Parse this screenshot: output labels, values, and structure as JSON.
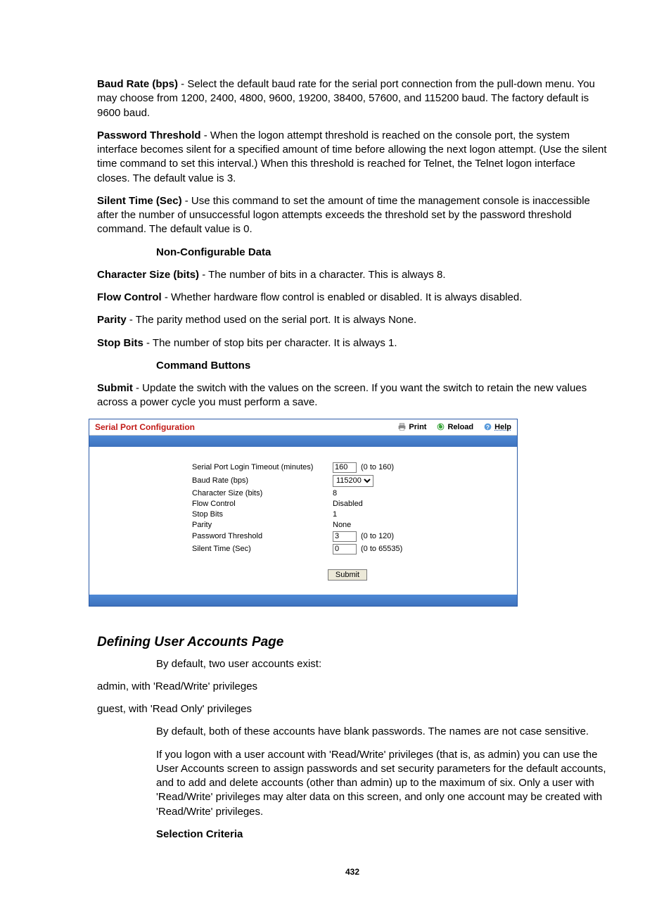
{
  "intro": [
    {
      "term": "Baud Rate (bps)",
      "text": " - Select the default baud rate for the serial port connection from the pull-down menu. You may choose from 1200, 2400, 4800, 9600, 19200, 38400, 57600, and 115200 baud. The factory default is 9600 baud."
    },
    {
      "term": "Password Threshold",
      "text": " - When the logon attempt threshold is reached on the console port, the system interface becomes silent for a specified amount of time before allowing the next logon attempt. (Use the silent time command to set this interval.) When this threshold is reached for Telnet, the Telnet logon interface closes. The default value is 3."
    },
    {
      "term": "Silent Time (Sec)",
      "text": " - Use this command to set the amount of time the management console is inaccessible after the number of unsuccessful logon attempts exceeds the threshold set by the password threshold command. The default value is 0."
    }
  ],
  "noncfg_heading": "Non-Configurable Data",
  "noncfg": [
    {
      "term": "Character Size (bits)",
      "text": " - The number of bits in a character. This is always 8."
    },
    {
      "term": "Flow Control",
      "text": " - Whether hardware flow control is enabled or disabled. It is always disabled."
    },
    {
      "term": "Parity",
      "text": " - The parity method used on the serial port. It is always None."
    },
    {
      "term": "Stop Bits",
      "text": " - The number of stop bits per character. It is always 1."
    }
  ],
  "cmdbtn_heading": "Command Buttons",
  "cmdbtn": {
    "term": "Submit",
    "text": " - Update the switch with the values on the screen. If you want the switch to retain the new values across a power cycle you must perform a save."
  },
  "shot": {
    "title": "Serial Port Configuration",
    "actions": {
      "print": "Print",
      "reload": "Reload",
      "help": "Help"
    },
    "rows": {
      "timeout": {
        "label": "Serial Port Login Timeout (minutes)",
        "value": "160",
        "range": "(0 to 160)"
      },
      "baud": {
        "label": "Baud Rate (bps)",
        "value": "115200"
      },
      "charsize": {
        "label": "Character Size (bits)",
        "value": "8"
      },
      "flowctl": {
        "label": "Flow Control",
        "value": "Disabled"
      },
      "stopbits": {
        "label": "Stop Bits",
        "value": "1"
      },
      "parity": {
        "label": "Parity",
        "value": "None"
      },
      "pwdthr": {
        "label": "Password Threshold",
        "value": "3",
        "range": "(0 to 120)"
      },
      "silent": {
        "label": "Silent Time (Sec)",
        "value": "0",
        "range": "(0 to 65535)"
      }
    },
    "submit": "Submit"
  },
  "section2": {
    "title": "Defining User Accounts Page",
    "lead": "By default, two user accounts exist:",
    "li1": "admin, with 'Read/Write' privileges",
    "li2": "guest, with 'Read Only' privileges",
    "p1": "By default, both of these accounts have blank passwords. The names are not case sensitive.",
    "p2": "If you logon with a user account with 'Read/Write' privileges (that is, as admin) you can use the User Accounts screen to assign passwords and set security parameters for the default accounts, and to add and delete accounts (other than admin) up to the maximum of six. Only a user with 'Read/Write' privileges may alter data on this screen, and only one account may be created with 'Read/Write' privileges.",
    "selcrit": "Selection Criteria"
  },
  "page_number": "432"
}
